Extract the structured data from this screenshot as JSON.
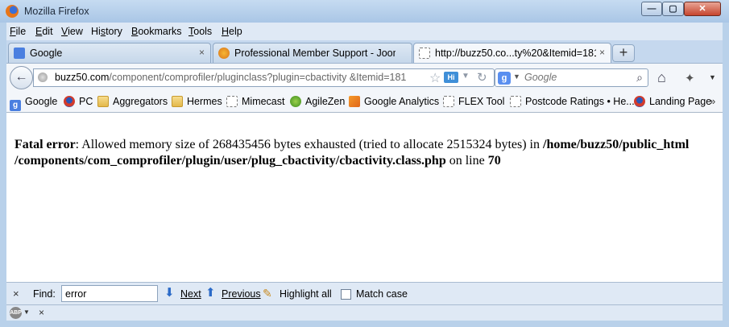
{
  "window": {
    "title": "Mozilla Firefox"
  },
  "window_controls": {
    "minimize": "—",
    "maximize": "▢",
    "close": "✕"
  },
  "menu": [
    {
      "accel": "F",
      "rest": "ile"
    },
    {
      "accel": "E",
      "rest": "dit"
    },
    {
      "accel": "V",
      "rest": "iew"
    },
    {
      "pre": "Hi",
      "accel": "s",
      "rest": "tory"
    },
    {
      "accel": "B",
      "rest": "ookmarks"
    },
    {
      "accel": "T",
      "rest": "ools"
    },
    {
      "accel": "H",
      "rest": "elp"
    }
  ],
  "tabs": [
    {
      "label": "Google",
      "icon": "google-favicon",
      "active": false
    },
    {
      "label": "Professional Member Support - Joom...",
      "icon": "joomla-favicon",
      "active": false
    },
    {
      "label": "http://buzz50.co...ty%20&Itemid=181",
      "icon": "blank-favicon",
      "active": true
    }
  ],
  "tab_close_glyph": "×",
  "new_tab_glyph": "+",
  "urlbar": {
    "host": "buzz50.com",
    "path": "/component/comprofiler/pluginclass?plugin=cbactivity &Itemid=181",
    "hi_badge": "Hi"
  },
  "searchbar": {
    "placeholder": "Google",
    "engine_badge": "g"
  },
  "bookmarks": [
    {
      "label": "Google",
      "icon": "google"
    },
    {
      "label": "PC",
      "icon": "pc"
    },
    {
      "label": "Aggregators",
      "icon": "folder"
    },
    {
      "label": "Hermes",
      "icon": "folder"
    },
    {
      "label": "Mimecast",
      "icon": "blank"
    },
    {
      "label": "AgileZen",
      "icon": "agile"
    },
    {
      "label": "Google Analytics",
      "icon": "analytics"
    },
    {
      "label": "FLEX Tool",
      "icon": "blank"
    },
    {
      "label": "Postcode Ratings • He...",
      "icon": "blank"
    },
    {
      "label": "Landing Page",
      "icon": "landing"
    }
  ],
  "bookmarks_overflow": "»",
  "page": {
    "error_label": "Fatal error",
    "error_message": ": Allowed memory size of 268435456 bytes exhausted (tried to allocate 2515324 bytes) in ",
    "error_path": "/home/buzz50/public_html /components/com_comprofiler/plugin/user/plug_cbactivity/cbactivity.class.php",
    "error_line_prefix": " on line ",
    "error_line": "70"
  },
  "findbar": {
    "close_glyph": "×",
    "label": "Find:",
    "query": "error",
    "next_label": "Next",
    "previous_label": "Previous",
    "highlight_label": "Highlight all",
    "match_case_label": "Match case",
    "match_case_checked": false
  },
  "statusbar": {
    "abp_badge": "ABP",
    "close_glyph": "×"
  }
}
